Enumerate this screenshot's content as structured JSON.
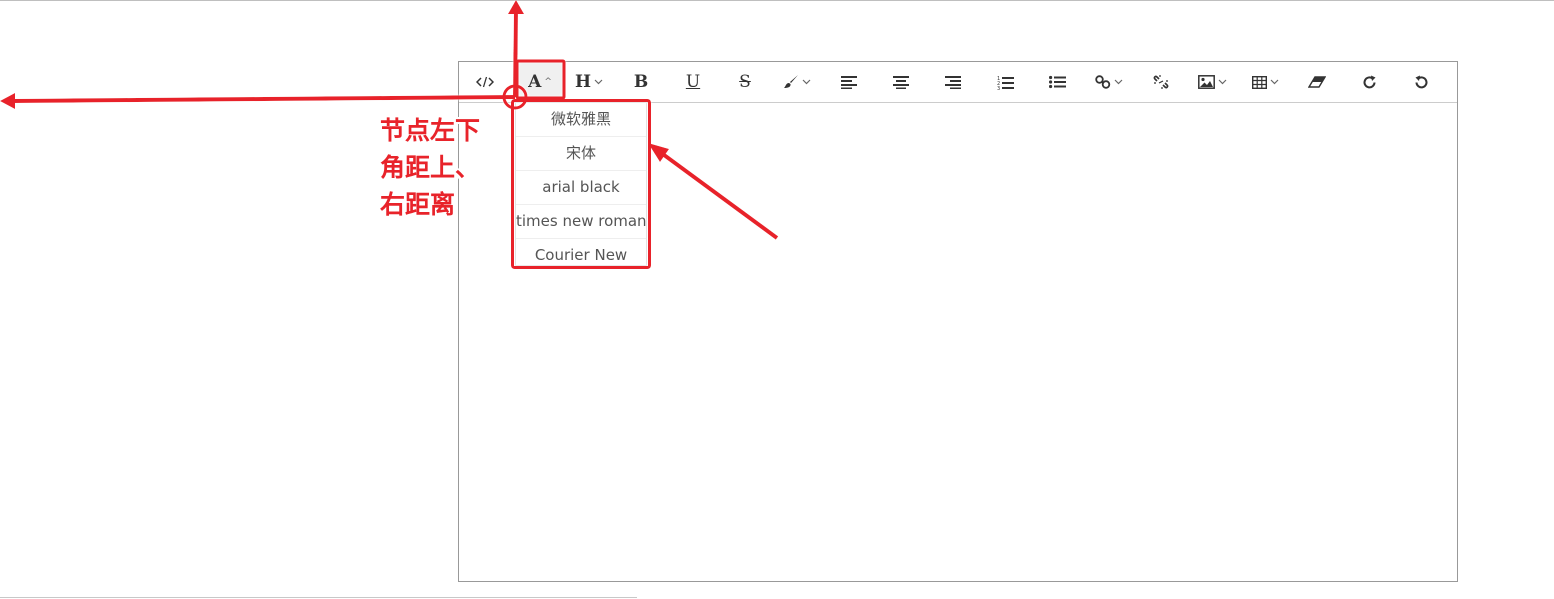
{
  "toolbar": {
    "buttons": [
      {
        "icon": "code-icon"
      },
      {
        "icon": "font-family-icon",
        "label": "A",
        "active": true
      },
      {
        "icon": "heading-icon",
        "label": "H"
      },
      {
        "icon": "bold-icon",
        "label": "B"
      },
      {
        "icon": "underline-icon",
        "label": "U"
      },
      {
        "icon": "strikethrough-icon",
        "label": "S"
      },
      {
        "icon": "paint-brush-icon"
      },
      {
        "icon": "align-left-icon"
      },
      {
        "icon": "align-center-icon"
      },
      {
        "icon": "align-right-icon"
      },
      {
        "icon": "ordered-list-icon"
      },
      {
        "icon": "unordered-list-icon"
      },
      {
        "icon": "link-icon"
      },
      {
        "icon": "unlink-icon"
      },
      {
        "icon": "image-icon"
      },
      {
        "icon": "table-icon"
      },
      {
        "icon": "eraser-icon"
      },
      {
        "icon": "redo-icon"
      },
      {
        "icon": "undo-icon"
      }
    ]
  },
  "font_dropdown": {
    "items": [
      "微软雅黑",
      "宋体",
      "arial black",
      "times new roman",
      "Courier New"
    ]
  },
  "annotation": {
    "lines": [
      "节点左下",
      "角距上、",
      "右距离"
    ],
    "color": "#e8232a"
  },
  "colors": {
    "editor_border": "#999999",
    "annotation_red": "#e8232a"
  }
}
